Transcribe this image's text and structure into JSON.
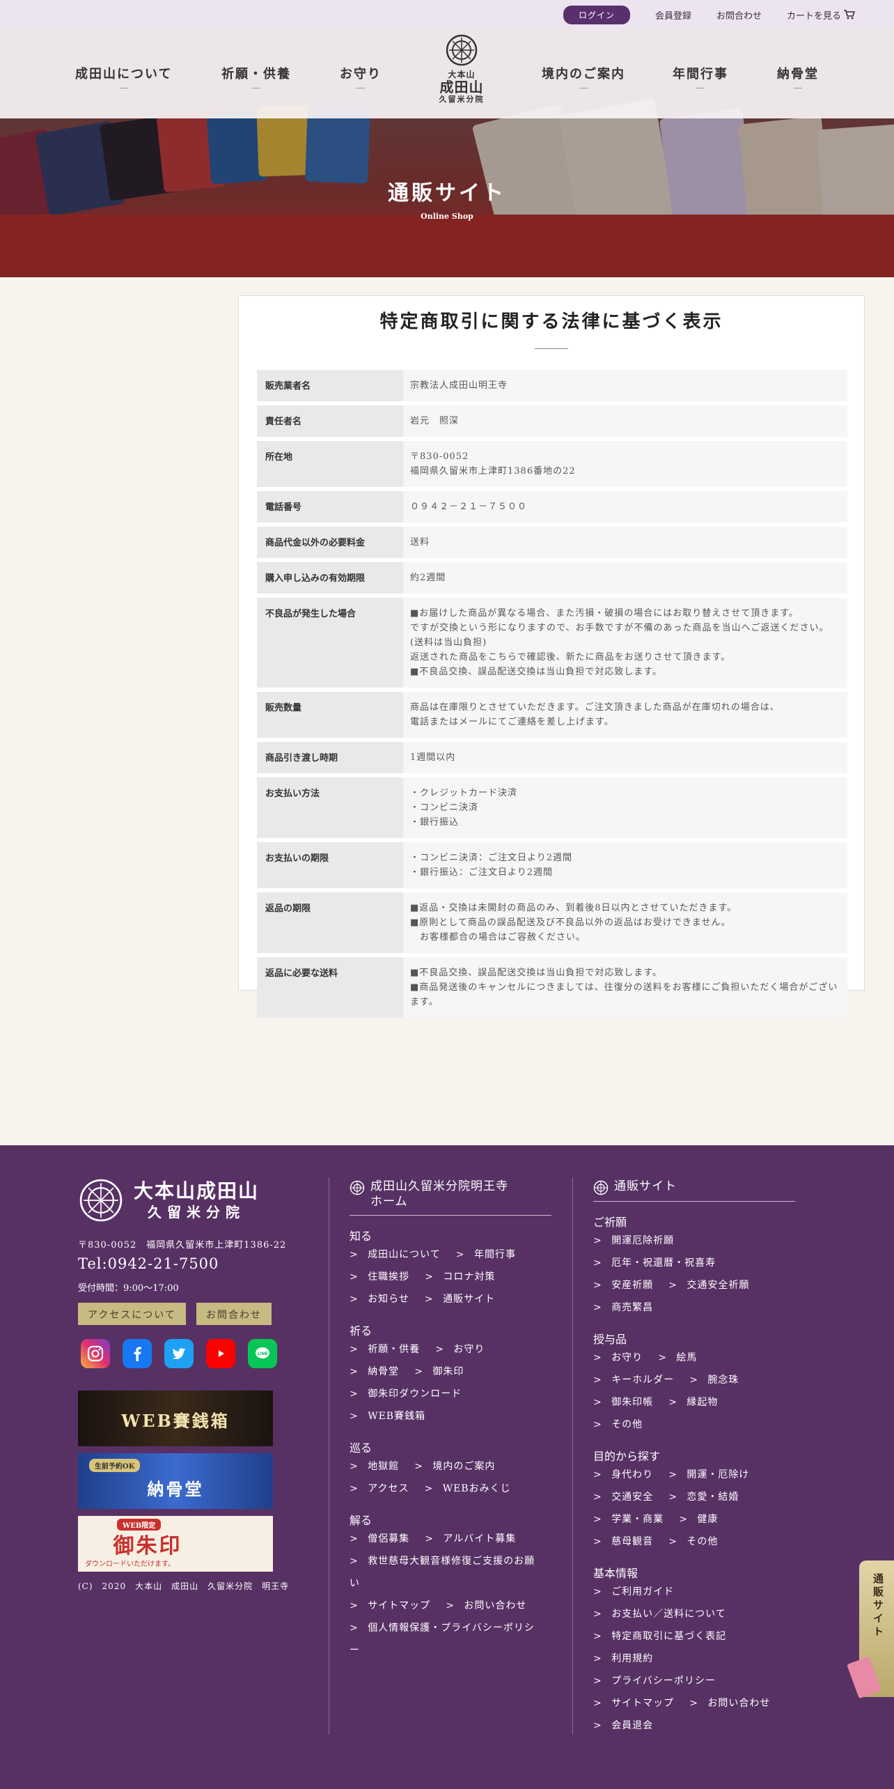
{
  "topbar": {
    "login": "ログイン",
    "register": "会員登録",
    "contact": "お問合わせ",
    "cart": "カートを見る"
  },
  "nav": {
    "items": [
      "成田山について",
      "祈願・供養",
      "お守り",
      "境内のご案内",
      "年間行事",
      "納骨堂"
    ],
    "logo": {
      "line1": "大本山",
      "line2": "成田山",
      "line3": "久留米分院"
    }
  },
  "hero": {
    "title": "通販サイト",
    "subtitle": "Online Shop"
  },
  "law": {
    "heading": "特定商取引に関する法律に基づく表示",
    "rows": [
      {
        "label": "販売業者名",
        "value": "宗教法人成田山明王寺"
      },
      {
        "label": "責任者名",
        "value": "岩元　照深"
      },
      {
        "label": "所在地",
        "value": "〒830-0052\n福岡県久留米市上津町1386番地の22"
      },
      {
        "label": "電話番号",
        "value": "０９４２－２１－７５００"
      },
      {
        "label": "商品代金以外の必要料金",
        "value": "送料"
      },
      {
        "label": "購入申し込みの有効期限",
        "value": "約2週間"
      },
      {
        "label": "不良品が発生した場合",
        "value": "■お届けした商品が異なる場合、また汚損・破損の場合にはお取り替えさせて頂きます。\nですが交換という形になりますので、お手数ですが不備のあった商品を当山へご返送ください。\n(送料は当山負担)\n返送された商品をこちらで確認後、新たに商品をお送りさせて頂きます。\n■不良品交換、誤品配送交換は当山負担で対応致します。"
      },
      {
        "label": "販売数量",
        "value": "商品は在庫限りとさせていただきます。ご注文頂きました商品が在庫切れの場合は、\n電話またはメールにてご連絡を差し上げます。"
      },
      {
        "label": "商品引き渡し時期",
        "value": "1週間以内"
      },
      {
        "label": "お支払い方法",
        "value": "・クレジットカード決済\n・コンビニ決済\n・銀行振込"
      },
      {
        "label": "お支払いの期限",
        "value": "・コンビニ決済：ご注文日より2週間\n・銀行振込：ご注文日より2週間"
      },
      {
        "label": "返品の期限",
        "value": "■返品・交換は未開封の商品のみ、到着後8日以内とさせていただきます。\n■原則として商品の誤品配送及び不良品以外の返品はお受けできません。\n　お客様都合の場合はご容赦ください。"
      },
      {
        "label": "返品に必要な送料",
        "value": "■不良品交換、誤品配送交換は当山負担で対応致します。\n■商品発送後のキャンセルにつきましては、往復分の送料をお客様にご負担いただく場合がございます。"
      }
    ]
  },
  "footer": {
    "logo": {
      "line1": "大本山成田山",
      "line2": "久留米分院"
    },
    "address": "〒830-0052　福岡県久留米市上津町1386-22",
    "tel": "Tel:0942-21-7500",
    "hours": "受付時間：9:00～17:00",
    "access_button": "アクセスについて",
    "contact_button": "お問合わせ",
    "banners": {
      "saisen": "WEB賽銭箱",
      "nokotsu": "納骨堂",
      "nokotsu_tag": "生前予約OK",
      "goshuin": "御朱印",
      "goshuin_tag": "WEB限定",
      "goshuin_note": "ダウンロードいただけます。"
    },
    "copyright": "(C)　2020　大本山　成田山　久留米分院　明王寺",
    "col1": {
      "head": "成田山久留米分院明王寺\nホーム",
      "groups": [
        {
          "title": "知る",
          "links": [
            "成田山について",
            "年間行事",
            "住職挨拶",
            "コロナ対策",
            "お知らせ",
            "通販サイト"
          ]
        },
        {
          "title": "祈る",
          "links": [
            "祈願・供養",
            "お守り",
            "納骨堂",
            "御朱印",
            "御朱印ダウンロード",
            "WEB賽銭箱"
          ]
        },
        {
          "title": "巡る",
          "links": [
            "地獄館",
            "境内のご案内",
            "アクセス",
            "WEBおみくじ"
          ]
        },
        {
          "title": "解る",
          "links": [
            "僧侶募集",
            "アルバイト募集",
            "救世慈母大観音様修復ご支援のお願い",
            "サイトマップ",
            "お問い合わせ",
            "個人情報保護・プライバシーポリシー"
          ]
        }
      ]
    },
    "col2": {
      "head": "通販サイト",
      "groups": [
        {
          "title": "ご祈願",
          "links": [
            "開運厄除祈願",
            "厄年・祝還暦・祝喜寿",
            "安産祈願",
            "交通安全祈願",
            "商売繁昌"
          ]
        },
        {
          "title": "授与品",
          "links": [
            "お守り",
            "絵馬",
            "キーホルダー",
            "腕念珠",
            "御朱印帳",
            "縁起物",
            "その他"
          ]
        },
        {
          "title": "目的から探す",
          "links": [
            "身代わり",
            "開運・厄除け",
            "交通安全",
            "恋愛・結婚",
            "学業・商業",
            "健康",
            "慈母観音",
            "その他"
          ]
        },
        {
          "title": "基本情報",
          "links": [
            "ご利用ガイド",
            "お支払い／送料について",
            "特定商取引に基づく表記",
            "利用規約",
            "プライバシーポリシー",
            "サイトマップ",
            "お問い合わせ",
            "会員退会"
          ]
        }
      ]
    },
    "float_tab": "通販サイト"
  },
  "colors": {
    "brand_purple": "#573164",
    "login_purple": "#5a2f6e",
    "gold": "#c6bb82"
  }
}
